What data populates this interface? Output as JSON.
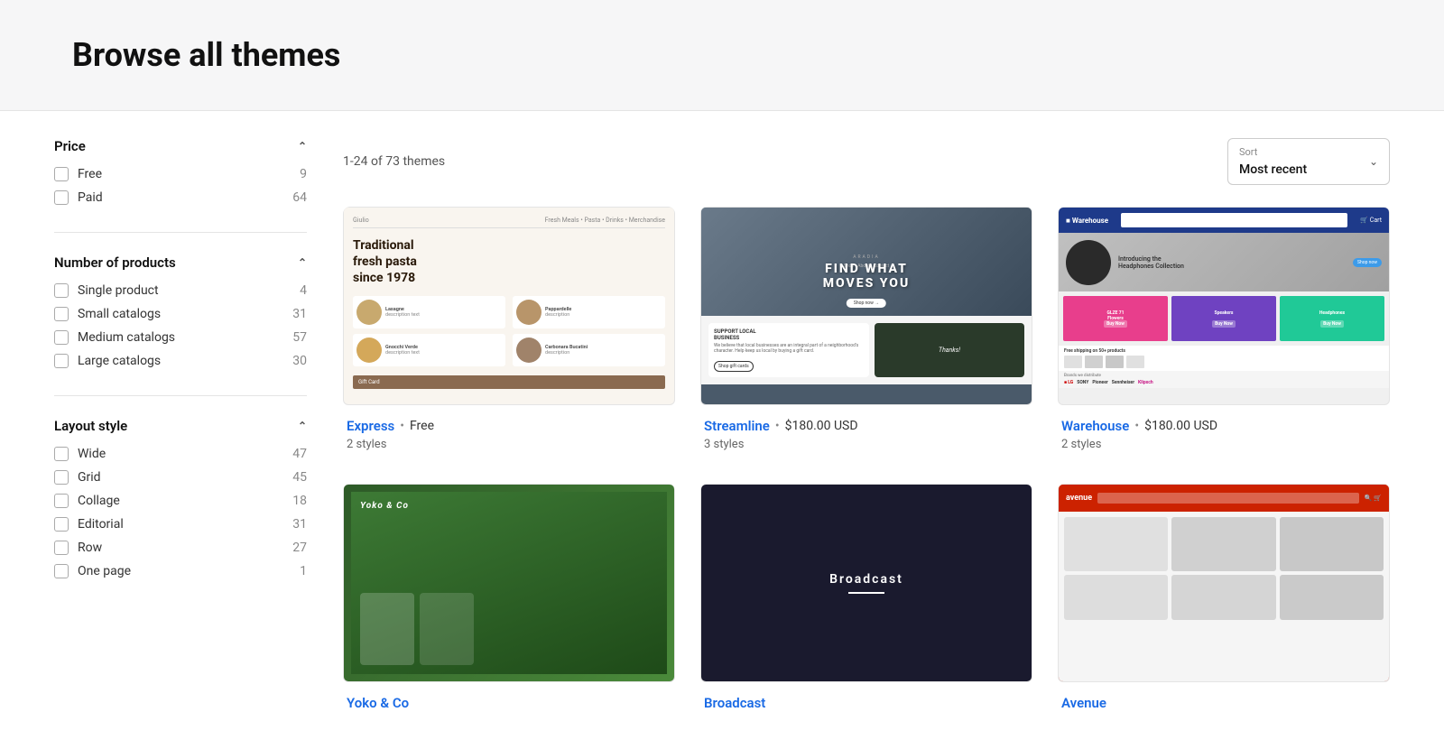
{
  "header": {
    "title": "Browse all themes"
  },
  "sidebar": {
    "filters": [
      {
        "id": "price",
        "label": "Price",
        "expanded": true,
        "items": [
          {
            "label": "Free",
            "count": 9
          },
          {
            "label": "Paid",
            "count": 64
          }
        ]
      },
      {
        "id": "number-of-products",
        "label": "Number of products",
        "expanded": true,
        "items": [
          {
            "label": "Single product",
            "count": 4
          },
          {
            "label": "Small catalogs",
            "count": 31
          },
          {
            "label": "Medium catalogs",
            "count": 57
          },
          {
            "label": "Large catalogs",
            "count": 30
          }
        ]
      },
      {
        "id": "layout-style",
        "label": "Layout style",
        "expanded": true,
        "items": [
          {
            "label": "Wide",
            "count": 47
          },
          {
            "label": "Grid",
            "count": 45
          },
          {
            "label": "Collage",
            "count": 18
          },
          {
            "label": "Editorial",
            "count": 31
          },
          {
            "label": "Row",
            "count": 27
          },
          {
            "label": "One page",
            "count": 1
          }
        ]
      }
    ]
  },
  "content": {
    "themes_count_label": "1-24 of 73 themes",
    "sort": {
      "label": "Sort",
      "value": "Most recent"
    },
    "themes": [
      {
        "id": "express",
        "name": "Express",
        "price_label": "Free",
        "is_free": true,
        "styles_label": "2 styles",
        "preview_type": "express"
      },
      {
        "id": "streamline",
        "name": "Streamline",
        "price_label": "$180.00 USD",
        "is_free": false,
        "styles_label": "3 styles",
        "preview_type": "streamline"
      },
      {
        "id": "warehouse",
        "name": "Warehouse",
        "price_label": "$180.00 USD",
        "is_free": false,
        "styles_label": "2 styles",
        "preview_type": "warehouse"
      },
      {
        "id": "yoko",
        "name": "Yoko & Co",
        "price_label": "",
        "is_free": false,
        "styles_label": "",
        "preview_type": "yoko"
      },
      {
        "id": "broadcast",
        "name": "Broadcast",
        "price_label": "",
        "is_free": false,
        "styles_label": "",
        "preview_type": "broadcast"
      },
      {
        "id": "avenue",
        "name": "Avenue",
        "price_label": "",
        "is_free": false,
        "styles_label": "",
        "preview_type": "avenue"
      }
    ]
  }
}
